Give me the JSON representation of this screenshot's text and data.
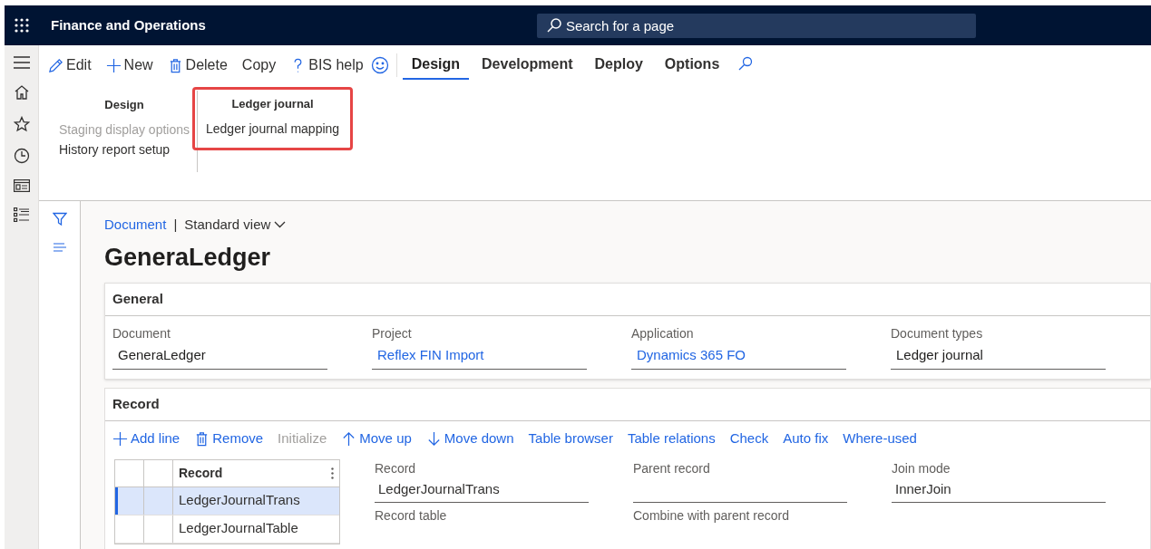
{
  "app_title": "Finance and Operations",
  "search": {
    "placeholder": "Search for a page"
  },
  "action_buttons": [
    {
      "label": "Edit",
      "kind": "pencil"
    },
    {
      "label": "New",
      "kind": "plus"
    },
    {
      "label": "Delete",
      "kind": "trash"
    },
    {
      "label": "Copy",
      "kind": "plain"
    },
    {
      "label": "BIS help",
      "kind": "question"
    }
  ],
  "tabs": [
    {
      "label": "Design",
      "selected": true
    },
    {
      "label": "Development",
      "selected": false
    },
    {
      "label": "Deploy",
      "selected": false
    },
    {
      "label": "Options",
      "selected": false
    }
  ],
  "ribbon_groups": [
    {
      "title": "Design",
      "highlighted": false,
      "items": [
        {
          "label": "Staging display options",
          "disabled": true
        },
        {
          "label": "History report setup",
          "disabled": false
        }
      ]
    },
    {
      "title": "Ledger journal",
      "highlighted": true,
      "items": [
        {
          "label": "Ledger journal mapping",
          "disabled": false
        }
      ]
    }
  ],
  "breadcrumb": {
    "link": "Document",
    "separator": "|",
    "view": "Standard view"
  },
  "page_title": "GeneraLedger",
  "general": {
    "title": "General",
    "fields": [
      {
        "label": "Document",
        "value": "GeneraLedger",
        "link": false
      },
      {
        "label": "Project",
        "value": "Reflex FIN Import",
        "link": true
      },
      {
        "label": "Application",
        "value": "Dynamics 365 FO",
        "link": true
      },
      {
        "label": "Document types",
        "value": "Ledger journal",
        "link": false
      }
    ]
  },
  "record": {
    "title": "Record",
    "toolbar": [
      {
        "label": "Add line",
        "kind": "plus",
        "disabled": false
      },
      {
        "label": "Remove",
        "kind": "trash",
        "disabled": false
      },
      {
        "label": "Initialize",
        "kind": "plain",
        "disabled": true
      },
      {
        "label": "Move up",
        "kind": "up",
        "disabled": false
      },
      {
        "label": "Move down",
        "kind": "down",
        "disabled": false
      },
      {
        "label": "Table browser",
        "kind": "plain",
        "disabled": false
      },
      {
        "label": "Table relations",
        "kind": "plain",
        "disabled": false
      },
      {
        "label": "Check",
        "kind": "plain",
        "disabled": false
      },
      {
        "label": "Auto fix",
        "kind": "plain",
        "disabled": false
      },
      {
        "label": "Where-used",
        "kind": "plain",
        "disabled": false
      }
    ],
    "grid": {
      "column": "Record",
      "rows": [
        {
          "value": "LedgerJournalTrans",
          "selected": true
        },
        {
          "value": "LedgerJournalTable",
          "selected": false
        }
      ]
    },
    "fields": [
      {
        "label": "Record",
        "value": "LedgerJournalTrans"
      },
      {
        "label": "Parent record"
      },
      {
        "label": "Join mode",
        "value": "InnerJoin"
      }
    ],
    "more_labels": [
      "Record table",
      "Combine with parent record"
    ]
  }
}
